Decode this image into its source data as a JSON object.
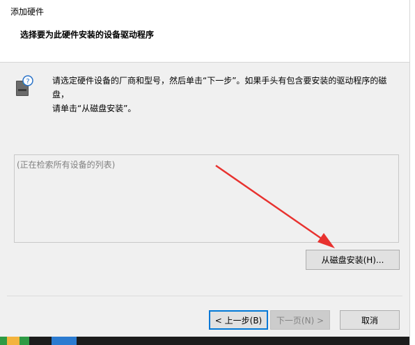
{
  "window": {
    "title": "添加硬件"
  },
  "header": {
    "heading": "选择要为此硬件安装的设备驱动程序"
  },
  "instruction": {
    "line1": "请选定硬件设备的厂商和型号，然后单击“下一步”。如果手头有包含要安装的驱动程序的磁盘，",
    "line2": "请单击“从磁盘安装”。"
  },
  "device_list": {
    "status_text": "(正在检索所有设备的列表)"
  },
  "buttons": {
    "have_disk": "从磁盘安装(H)...",
    "back": "< 上一步(B)",
    "next": "下一页(N) >",
    "cancel": "取消"
  },
  "icons": {
    "header_icon": "hardware-help-icon"
  },
  "colors": {
    "annotation_arrow": "#e8322f",
    "focus_border": "#0078d7"
  }
}
